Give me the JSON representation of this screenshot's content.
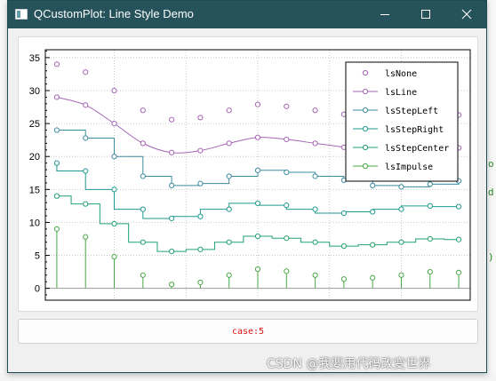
{
  "window": {
    "title": "QCustomPlot: Line Style Demo"
  },
  "case_button": {
    "label": "case:5"
  },
  "watermark": {
    "text": "CSDN @我要用代码改变世界"
  },
  "background_code": [
    "o",
    "d",
    ")"
  ],
  "chart_data": {
    "type": "line",
    "xlim": [
      -0.4,
      14.4
    ],
    "ylim": [
      -1.8,
      36.2
    ],
    "yticks": [
      0,
      5,
      10,
      15,
      20,
      25,
      30,
      35
    ],
    "grid": true,
    "legend_position": "top-right",
    "series": [
      {
        "name": "lsNone",
        "style": "none",
        "color": "#a565b5",
        "x": [
          0,
          1,
          2,
          3,
          4,
          5,
          6,
          7,
          8,
          9,
          10,
          11,
          12,
          13,
          14
        ],
        "y": [
          34.0,
          32.8,
          30.0,
          27.0,
          25.6,
          25.9,
          27.0,
          27.9,
          27.6,
          27.0,
          26.4,
          25.6,
          25.4,
          25.8,
          26.3
        ]
      },
      {
        "name": "lsLine",
        "style": "line",
        "color": "#a565b5",
        "x": [
          0,
          1,
          2,
          3,
          4,
          5,
          6,
          7,
          8,
          9,
          10,
          11,
          12,
          13,
          14
        ],
        "y": [
          29.0,
          27.8,
          25.0,
          22.0,
          20.6,
          20.9,
          22.0,
          22.9,
          22.6,
          22.0,
          21.4,
          20.6,
          20.4,
          20.8,
          21.3
        ]
      },
      {
        "name": "lsStepLeft",
        "style": "stepLeft",
        "color": "#3c8ba0",
        "x": [
          0,
          1,
          2,
          3,
          4,
          5,
          6,
          7,
          8,
          9,
          10,
          11,
          12,
          13,
          14
        ],
        "y": [
          24.0,
          22.8,
          20.0,
          17.0,
          15.6,
          15.9,
          17.0,
          17.9,
          17.6,
          17.0,
          16.4,
          15.6,
          15.4,
          15.8,
          16.3
        ]
      },
      {
        "name": "lsStepRight",
        "style": "stepRight",
        "color": "#1f9a90",
        "x": [
          0,
          1,
          2,
          3,
          4,
          5,
          6,
          7,
          8,
          9,
          10,
          11,
          12,
          13,
          14
        ],
        "y": [
          19.0,
          17.8,
          15.0,
          12.0,
          10.6,
          10.9,
          12.0,
          12.9,
          12.6,
          12.0,
          11.4,
          11.6,
          12.0,
          12.5,
          12.4
        ]
      },
      {
        "name": "lsStepCenter",
        "style": "stepCenter",
        "color": "#22a270",
        "x": [
          0,
          1,
          2,
          3,
          4,
          5,
          6,
          7,
          8,
          9,
          10,
          11,
          12,
          13,
          14
        ],
        "y": [
          14.0,
          12.8,
          9.8,
          7.0,
          5.6,
          5.9,
          7.0,
          7.9,
          7.6,
          7.0,
          6.4,
          6.6,
          7.0,
          7.5,
          7.4
        ]
      },
      {
        "name": "lsImpulse",
        "style": "impulse",
        "color": "#4aa846",
        "x": [
          0,
          1,
          2,
          3,
          4,
          5,
          6,
          7,
          8,
          9,
          10,
          11,
          12,
          13,
          14
        ],
        "y": [
          9.0,
          7.8,
          4.8,
          2.0,
          0.6,
          0.9,
          2.0,
          2.9,
          2.6,
          2.0,
          1.4,
          1.6,
          2.0,
          2.5,
          2.4
        ]
      }
    ]
  }
}
